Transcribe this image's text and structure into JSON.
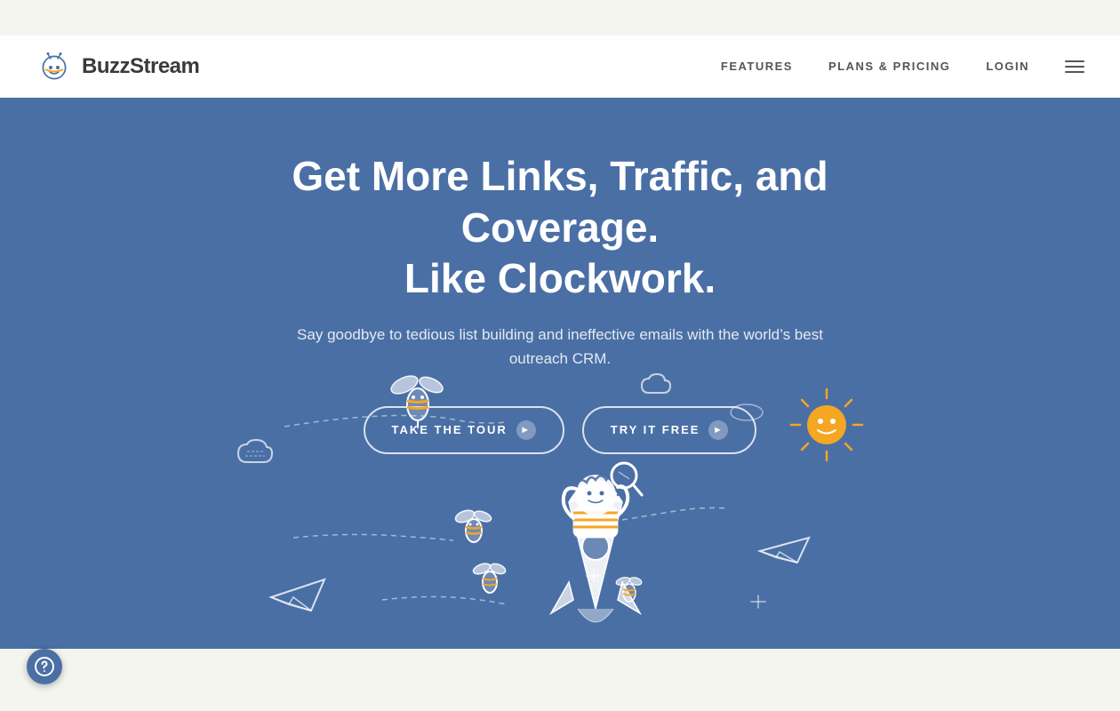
{
  "topbar": {
    "visible": true
  },
  "header": {
    "logo": {
      "text": "BuzzStream",
      "alt": "BuzzStream logo"
    },
    "nav": {
      "items": [
        {
          "label": "FEATURES",
          "key": "features"
        },
        {
          "label": "PLANS & PRICING",
          "key": "plans"
        },
        {
          "label": "LOGIN",
          "key": "login"
        }
      ],
      "menu_icon_alt": "hamburger menu"
    }
  },
  "hero": {
    "title_line1": "Get More Links, Traffic, and Coverage.",
    "title_line2": "Like Clockwork.",
    "subtitle": "Say goodbye to tedious list building and ineffective emails with the world’s best outreach CRM.",
    "btn_tour_label": "TAKE THE TOUR",
    "btn_free_label": "TRY IT FREE",
    "btn_arrow": "►"
  },
  "hint_widget": {
    "alt": "help widget icon"
  },
  "colors": {
    "hero_bg": "#4a6fa5",
    "header_bg": "#ffffff",
    "body_bg": "#f5f5f0",
    "text_white": "#ffffff",
    "nav_text": "#555555",
    "logo_text": "#3a3a3a"
  }
}
